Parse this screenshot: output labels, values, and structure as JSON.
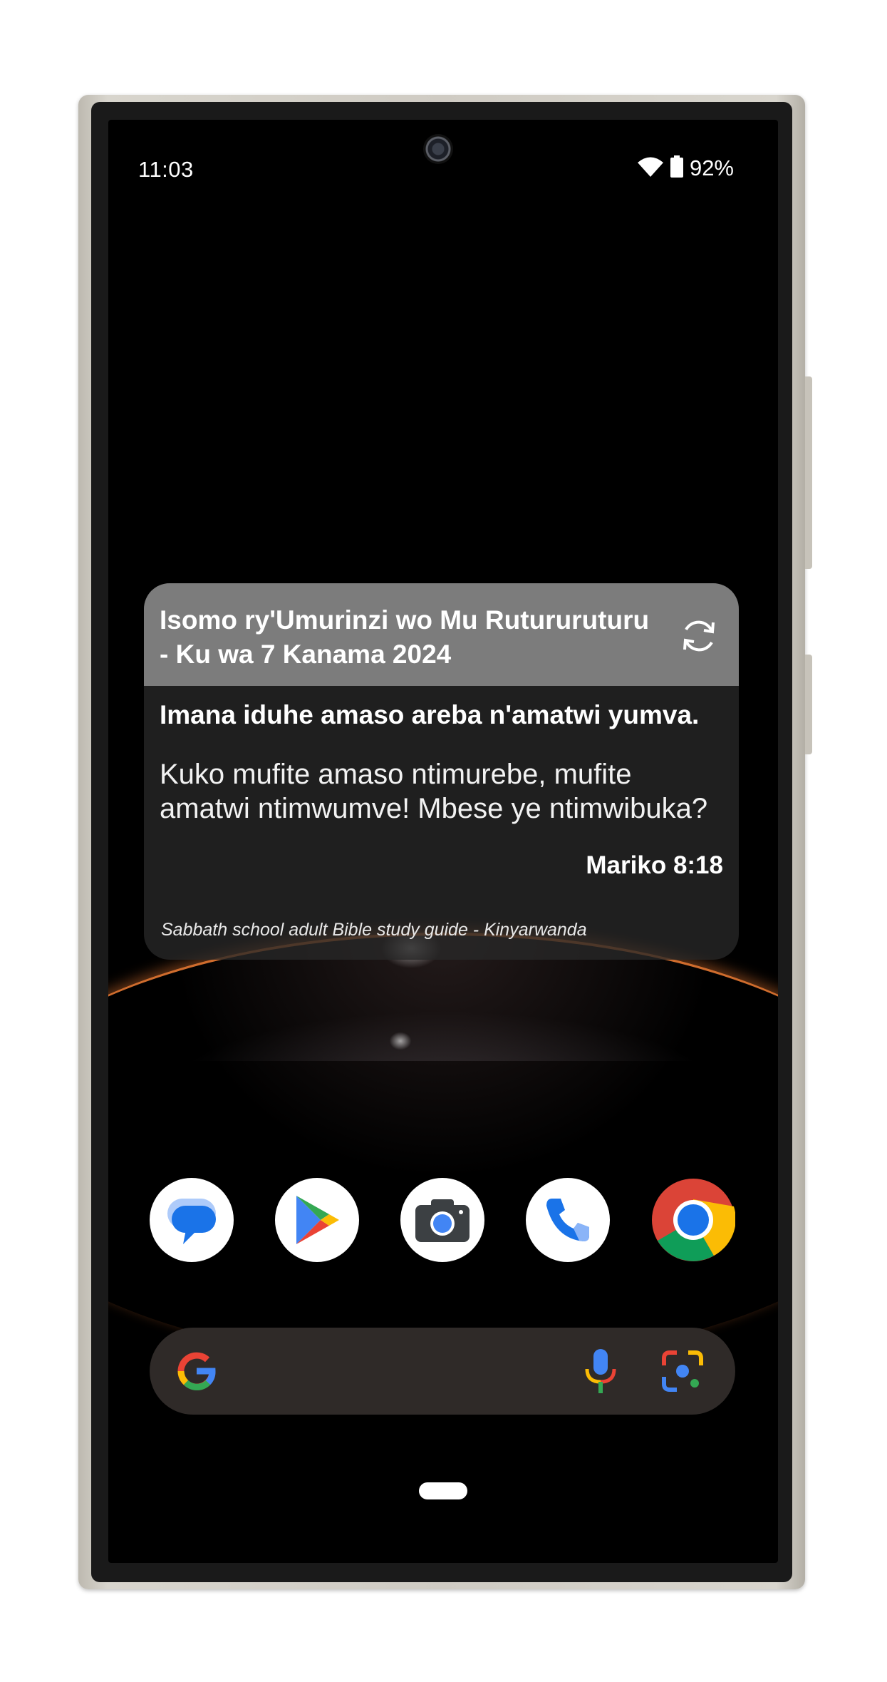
{
  "status_bar": {
    "time": "11:03",
    "battery_percent": "92%",
    "icons": [
      "wifi-icon",
      "battery-icon"
    ]
  },
  "widget": {
    "title": "Isomo ry'Umurinzi wo Mu Rutururuturu - Ku wa 7 Kanama 2024",
    "refresh_icon": "refresh-icon",
    "verse_heading": "Imana iduhe amaso areba n'amatwi yumva.",
    "verse_text": "Kuko mufite amaso ntimurebe, mufite amatwi ntimwumve! Mbese ye ntimwibuka?",
    "verse_reference": "Mariko 8:18",
    "source": "Sabbath school adult Bible study guide - Kinyarwanda"
  },
  "dock": {
    "apps": [
      {
        "name": "Messages",
        "icon": "messages-icon"
      },
      {
        "name": "Play Store",
        "icon": "play-store-icon"
      },
      {
        "name": "Camera",
        "icon": "camera-icon"
      },
      {
        "name": "Phone",
        "icon": "phone-icon"
      },
      {
        "name": "Chrome",
        "icon": "chrome-icon"
      }
    ]
  },
  "search_bar": {
    "icons": [
      "google-g-icon",
      "microphone-icon",
      "google-lens-icon"
    ]
  },
  "colors": {
    "widget_header": "#7c7c7c",
    "search_bar": "#2f2a28",
    "google_blue": "#4285f4",
    "google_red": "#ea4335",
    "google_yellow": "#fbbc05",
    "google_green": "#34a853"
  }
}
